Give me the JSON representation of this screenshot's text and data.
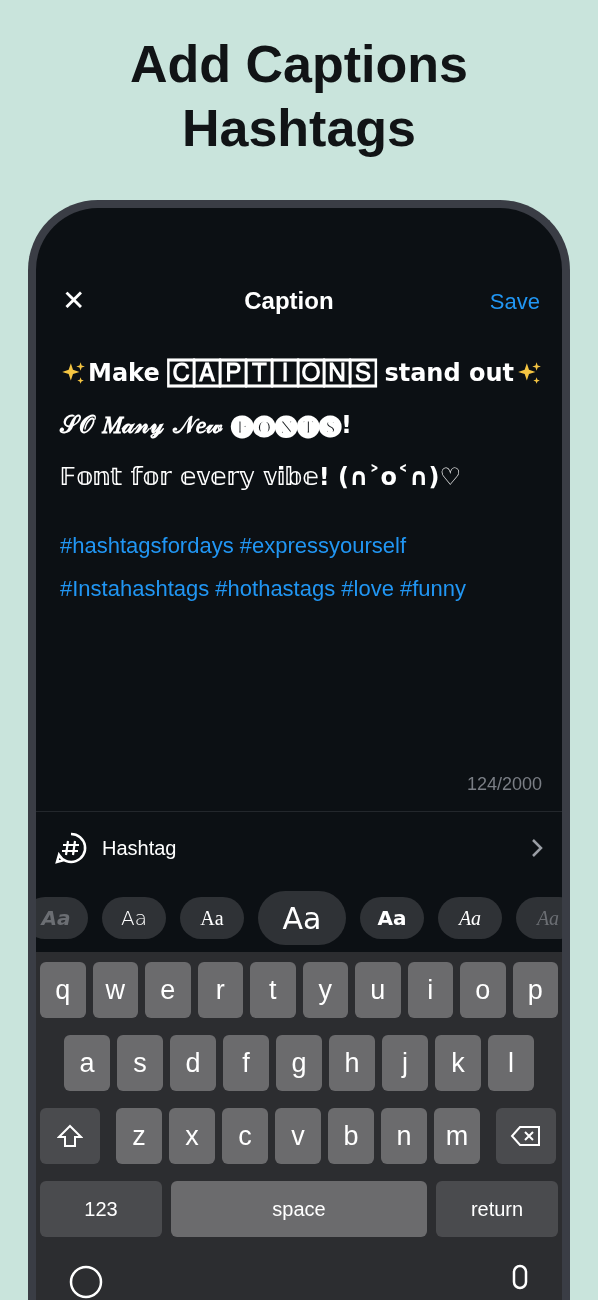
{
  "headline": [
    "Add Captions",
    "Hashtags"
  ],
  "nav": {
    "close": "✕",
    "title": "Caption",
    "save": "Save"
  },
  "caption_lines": [
    {
      "kind": "sparkle",
      "text": "Make 🄲🄰🄿🅃🄸🄾🄽🅂 stand out"
    },
    {
      "kind": "plain",
      "text": "𝒮𝒪 𝑀𝒶𝓃𝓎 𝒩𝑒𝓌 🅕🅞🅝🅣🅢!"
    },
    {
      "kind": "plain",
      "text": "𝔽𝕠𝕟𝕥 𝕗𝕠𝕣 𝕖𝕧𝕖𝕣𝕪 𝕧𝕚𝕓𝕖! (∩˃o˂∩)♡"
    }
  ],
  "hashtags": "#hashtagsfordays #expressyourself #Instahashtags #hothastags #love #funny",
  "counter": "124/2000",
  "hashtag_row": {
    "label": "Hashtag"
  },
  "font_chips": [
    {
      "label": "Aa",
      "kind": "heavy",
      "selected": false
    },
    {
      "label": "Aa",
      "kind": "hand",
      "selected": false
    },
    {
      "label": "Aa",
      "kind": "serif",
      "selected": false
    },
    {
      "label": "Aa",
      "kind": "outline",
      "selected": true
    },
    {
      "label": "Aa",
      "kind": "bold",
      "selected": false
    },
    {
      "label": "Aa",
      "kind": "script",
      "selected": false
    },
    {
      "label": "Aa",
      "kind": "italic",
      "selected": false
    }
  ],
  "keyboard": {
    "rows": [
      [
        "q",
        "w",
        "e",
        "r",
        "t",
        "y",
        "u",
        "i",
        "o",
        "p"
      ],
      [
        "a",
        "s",
        "d",
        "f",
        "g",
        "h",
        "j",
        "k",
        "l"
      ],
      [
        "z",
        "x",
        "c",
        "v",
        "b",
        "n",
        "m"
      ]
    ],
    "numbers": "123",
    "space": "space",
    "return": "return"
  }
}
